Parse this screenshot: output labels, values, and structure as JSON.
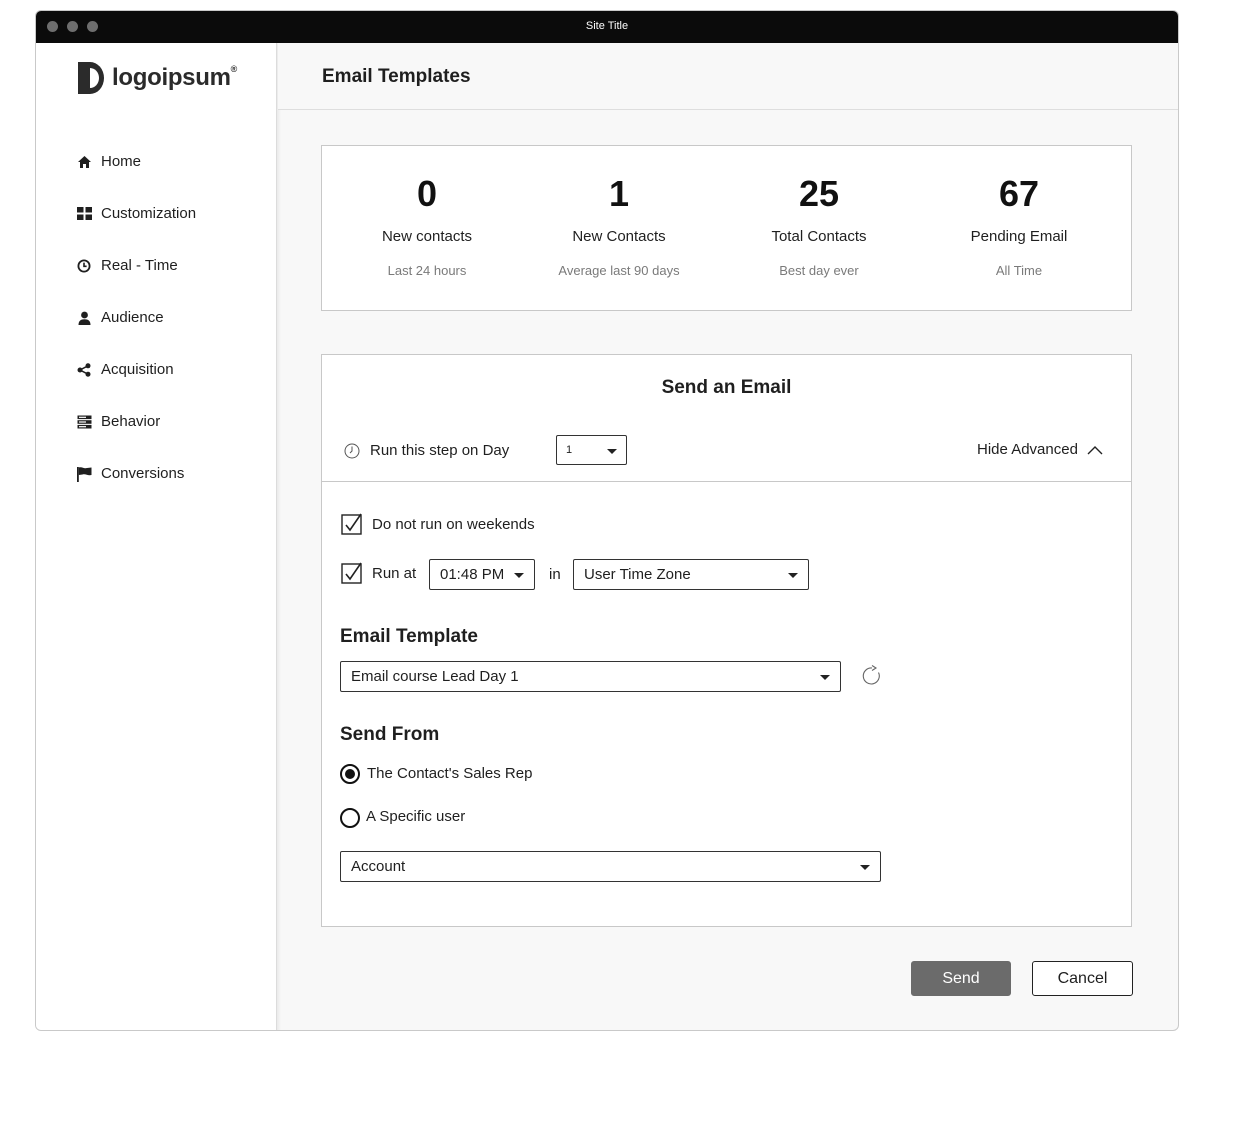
{
  "window": {
    "title": "Site Title"
  },
  "brand": {
    "name": "logoipsum",
    "mark": "®"
  },
  "sidebar": {
    "items": [
      {
        "label": "Home",
        "icon": "home-icon"
      },
      {
        "label": "Customization",
        "icon": "grid-icon"
      },
      {
        "label": "Real - Time",
        "icon": "clock-icon"
      },
      {
        "label": "Audience",
        "icon": "user-icon"
      },
      {
        "label": "Acquisition",
        "icon": "share-icon"
      },
      {
        "label": "Behavior",
        "icon": "server-icon"
      },
      {
        "label": "Conversions",
        "icon": "flag-icon"
      }
    ]
  },
  "header": {
    "title": "Email Templates"
  },
  "stats": [
    {
      "value": "0",
      "label": "New contacts",
      "sub": "Last 24 hours"
    },
    {
      "value": "1",
      "label": "New Contacts",
      "sub": "Average last 90 days"
    },
    {
      "value": "25",
      "label": "Total Contacts",
      "sub": "Best day ever"
    },
    {
      "value": "67",
      "label": "Pending Email",
      "sub": "All Time"
    }
  ],
  "email_form": {
    "title": "Send an Email",
    "run_step_label": "Run this step on Day",
    "day_value": "1",
    "hide_advanced_label": "Hide Advanced",
    "weekends": {
      "label": "Do not run on weekends",
      "checked": true
    },
    "run_at": {
      "label": "Run at",
      "checked": true,
      "time": "01:48 PM",
      "in_label": "in",
      "timezone": "User Time Zone"
    },
    "template": {
      "section_title": "Email Template",
      "value": "Email course Lead Day 1"
    },
    "send_from": {
      "section_title": "Send From",
      "options": [
        {
          "label": "The Contact's Sales Rep",
          "selected": true
        },
        {
          "label": "A Specific user",
          "selected": false
        }
      ],
      "account_value": "Account"
    }
  },
  "actions": {
    "send_label": "Send",
    "cancel_label": "Cancel"
  },
  "colors": {
    "titlebar": "#0b0b0b",
    "send_button": "#6b6b6b",
    "border": "#c8c8c8"
  }
}
